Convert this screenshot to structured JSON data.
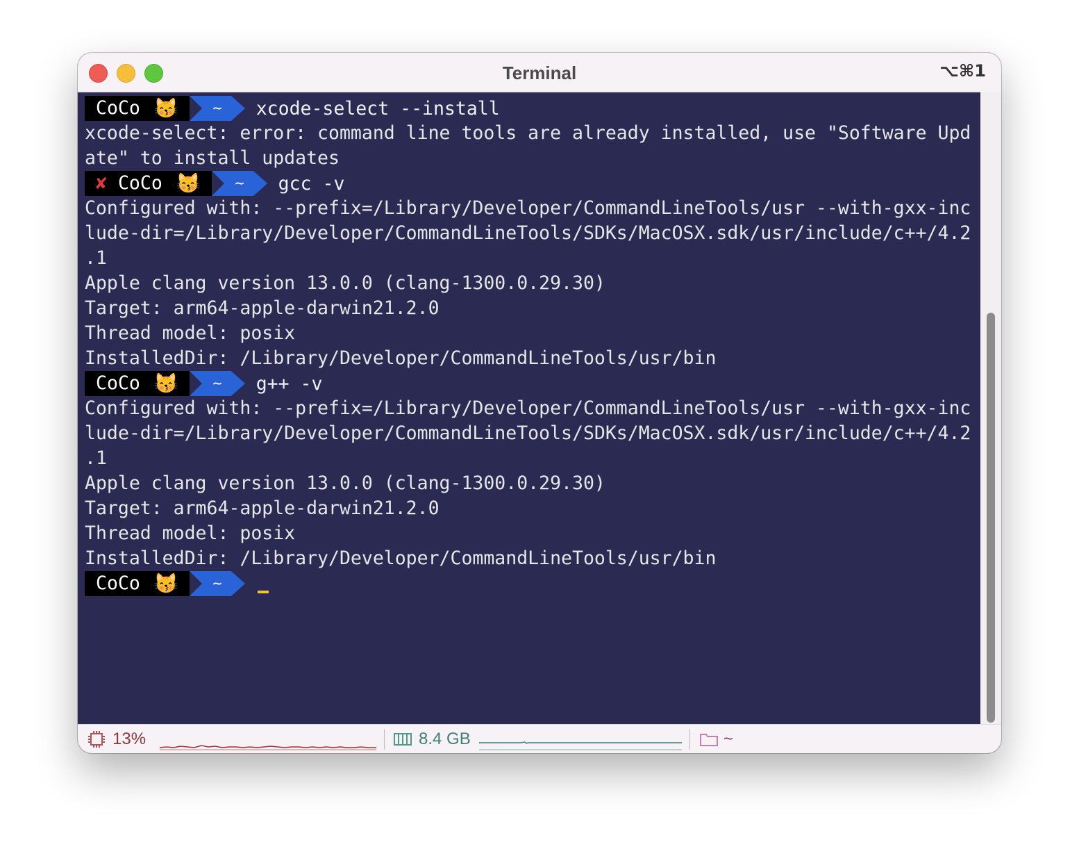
{
  "window": {
    "title": "Terminal",
    "shortcut": "⌥⌘1"
  },
  "prompts": [
    {
      "user": "CoCo",
      "emoji": "😽",
      "dir": "~",
      "command": "xcode-select --install",
      "error": ""
    },
    {
      "user": "CoCo",
      "emoji": "😽",
      "dir": "~",
      "command": "gcc -v",
      "error": "✘"
    },
    {
      "user": "CoCo",
      "emoji": "😽",
      "dir": "~",
      "command": "g++ -v",
      "error": ""
    },
    {
      "user": "CoCo",
      "emoji": "😽",
      "dir": "~",
      "command": "",
      "error": ""
    }
  ],
  "output": {
    "block1": [
      "xcode-select: error: command line tools are already installed, use \"Software Upd",
      "ate\" to install updates"
    ],
    "block2": [
      "Configured with: --prefix=/Library/Developer/CommandLineTools/usr --with-gxx-inc",
      "lude-dir=/Library/Developer/CommandLineTools/SDKs/MacOSX.sdk/usr/include/c++/4.2",
      ".1",
      "Apple clang version 13.0.0 (clang-1300.0.29.30)",
      "Target: arm64-apple-darwin21.2.0",
      "Thread model: posix",
      "InstalledDir: /Library/Developer/CommandLineTools/usr/bin"
    ],
    "block3": [
      "Configured with: --prefix=/Library/Developer/CommandLineTools/usr --with-gxx-inc",
      "lude-dir=/Library/Developer/CommandLineTools/SDKs/MacOSX.sdk/usr/include/c++/4.2",
      ".1",
      "Apple clang version 13.0.0 (clang-1300.0.29.30)",
      "Target: arm64-apple-darwin21.2.0",
      "Thread model: posix",
      "InstalledDir: /Library/Developer/CommandLineTools/usr/bin"
    ]
  },
  "statusbar": {
    "cpu": {
      "icon": "cpu-icon",
      "value": "13%"
    },
    "memory": {
      "icon": "memory-icon",
      "value": "8.4 GB"
    },
    "directory": {
      "icon": "folder-icon",
      "value": "~"
    }
  },
  "colors": {
    "terminal_bg": "#2a2a52",
    "prompt_user_bg": "#000000",
    "prompt_dir_bg": "#2a62d8",
    "error_mark": "#e0393c",
    "cursor": "#f1c232",
    "cpu_graph": "#a0302e",
    "memory_graph": "#3f7f74"
  }
}
